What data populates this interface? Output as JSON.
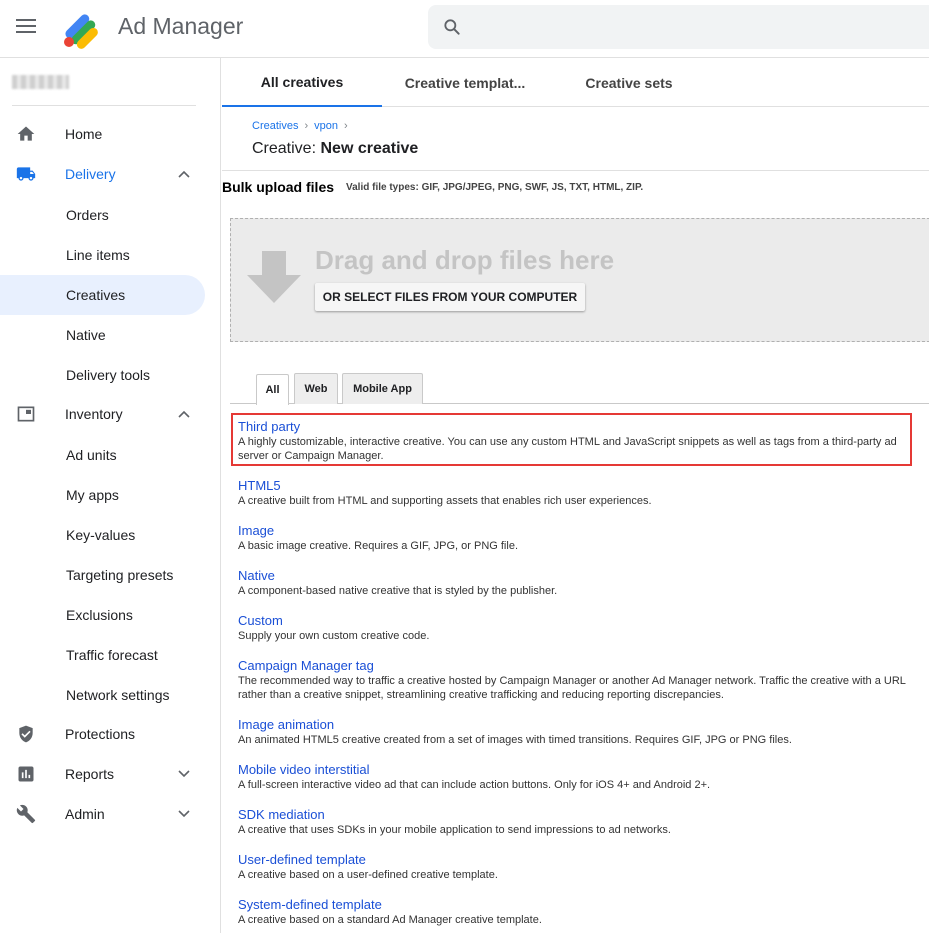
{
  "app": {
    "title": "Ad Manager"
  },
  "sidebar": {
    "items": [
      {
        "label": "Home"
      },
      {
        "label": "Delivery"
      },
      {
        "label": "Orders"
      },
      {
        "label": "Line items"
      },
      {
        "label": "Creatives"
      },
      {
        "label": "Native"
      },
      {
        "label": "Delivery tools"
      },
      {
        "label": "Inventory"
      },
      {
        "label": "Ad units"
      },
      {
        "label": "My apps"
      },
      {
        "label": "Key-values"
      },
      {
        "label": "Targeting presets"
      },
      {
        "label": "Exclusions"
      },
      {
        "label": "Traffic forecast"
      },
      {
        "label": "Network settings"
      },
      {
        "label": "Protections"
      },
      {
        "label": "Reports"
      },
      {
        "label": "Admin"
      }
    ]
  },
  "tabs": [
    {
      "label": "All creatives"
    },
    {
      "label": "Creative templat..."
    },
    {
      "label": "Creative sets"
    }
  ],
  "breadcrumb": {
    "items": [
      "Creatives",
      "vpon"
    ]
  },
  "page": {
    "title_prefix": "Creative:",
    "title_main": "New creative"
  },
  "bulk": {
    "title": "Bulk upload files",
    "valid_types": "Valid file types: GIF, JPG/JPEG, PNG, SWF, JS, TXT, HTML, ZIP.",
    "drop_text": "Drag and drop files here",
    "select_button": "OR SELECT FILES FROM YOUR COMPUTER"
  },
  "filter_tabs": [
    {
      "label": "All"
    },
    {
      "label": "Web"
    },
    {
      "label": "Mobile App"
    }
  ],
  "creative_types": [
    {
      "name": "Third party",
      "desc": "A highly customizable, interactive creative. You can use any custom HTML and JavaScript snippets as well as tags from a third-party ad server or Campaign Manager."
    },
    {
      "name": "HTML5",
      "desc": "A creative built from HTML and supporting assets that enables rich user experiences."
    },
    {
      "name": "Image",
      "desc": "A basic image creative. Requires a GIF, JPG, or PNG file."
    },
    {
      "name": "Native",
      "desc": "A component-based native creative that is styled by the publisher."
    },
    {
      "name": "Custom",
      "desc": "Supply your own custom creative code."
    },
    {
      "name": "Campaign Manager tag",
      "desc": "The recommended way to traffic a creative hosted by Campaign Manager or another Ad Manager network. Traffic the creative with a URL rather than a creative snippet, streamlining creative trafficking and reducing reporting discrepancies."
    },
    {
      "name": "Image animation",
      "desc": "An animated HTML5 creative created from a set of images with timed transitions. Requires GIF, JPG or PNG files."
    },
    {
      "name": "Mobile video interstitial",
      "desc": "A full-screen interactive video ad that can include action buttons. Only for iOS 4+ and Android 2+."
    },
    {
      "name": "SDK mediation",
      "desc": "A creative that uses SDKs in your mobile application to send impressions to ad networks."
    },
    {
      "name": "User-defined template",
      "desc": "A creative based on a user-defined creative template."
    },
    {
      "name": "System-defined template",
      "desc": "A creative based on a standard Ad Manager creative template."
    }
  ],
  "colors": {
    "accent": "#1a73e8",
    "highlight": "#e53935",
    "link": "#1a4fd6"
  }
}
